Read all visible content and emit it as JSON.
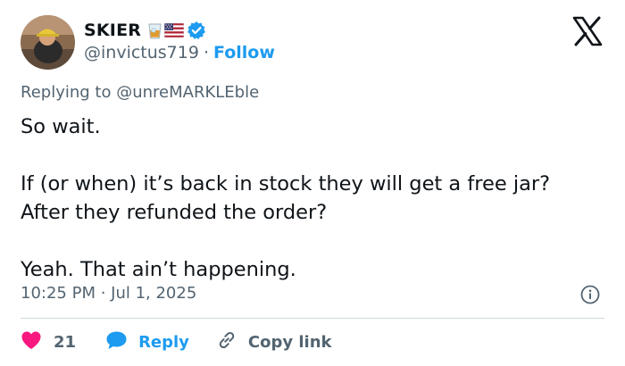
{
  "author": {
    "display_name": "SKIER",
    "handle": "@invictus719",
    "separator": "·",
    "follow_label": "Follow",
    "badges": [
      "tumbler-glass-emoji",
      "us-flag-emoji",
      "verified-badge"
    ]
  },
  "reply": {
    "prefix": "Replying to",
    "mention": "@unreMARKLEble"
  },
  "tweet": {
    "lines": [
      "So wait.",
      "If (or when) it’s back in stock they will get a free jar? After they refunded the order?",
      "Yeah. That ain’t happening."
    ]
  },
  "meta": {
    "timestamp": "10:25 PM · Jul 1, 2025"
  },
  "actions": {
    "like_count": "21",
    "reply_label": "Reply",
    "copy_label": "Copy link"
  },
  "colors": {
    "link_blue": "#1d9bf0",
    "text_primary": "#0f1419",
    "text_secondary": "#536471",
    "heart_red": "#f91880",
    "divider": "#cfd9de"
  },
  "icons": {
    "brand": "x-logo",
    "info": "info-icon",
    "like": "heart-icon",
    "reply": "reply-bubble-icon",
    "copy": "link-icon"
  }
}
